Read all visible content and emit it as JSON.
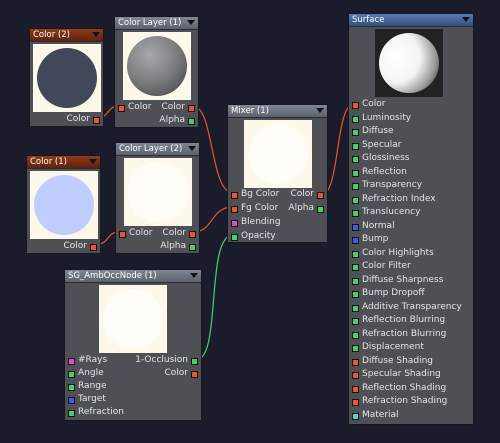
{
  "colors": {
    "background": "#1b1c2b",
    "wire_orange": "#f0532a",
    "wire_green": "#3fd36a",
    "port_orange": "#f0532a",
    "port_green": "#3fd36a",
    "port_blue": "#3f5ce8",
    "port_pink": "#e246d6",
    "swatch_color2": "#40485a",
    "swatch_color1": "#c0cdff"
  },
  "nodes": {
    "color2": {
      "title": "Color (2)",
      "out_color": "Color"
    },
    "color1": {
      "title": "Color (1)",
      "out_color": "Color"
    },
    "colorlayer1": {
      "title": "Color Layer (1)",
      "in_color": "Color",
      "out_color": "Color",
      "out_alpha": "Alpha"
    },
    "colorlayer2": {
      "title": "Color Layer (2)",
      "in_color": "Color",
      "out_color": "Color",
      "out_alpha": "Alpha"
    },
    "mixer": {
      "title": "Mixer (1)",
      "bg_color": "Bg Color",
      "fg_color": "Fg Color",
      "blending": "Blending",
      "opacity": "Opacity",
      "out_color": "Color",
      "out_alpha": "Alpha"
    },
    "ambocc": {
      "title": "SG_AmbOccNode (1)",
      "rays": "#Rays",
      "angle": "Angle",
      "range": "Range",
      "target": "Target",
      "refraction": "Refraction",
      "out_occlusion": "1-Occlusion",
      "out_color": "Color"
    },
    "surface": {
      "title": "Surface",
      "inputs": [
        {
          "label": "Color",
          "port": "orange"
        },
        {
          "label": "Luminosity",
          "port": "green"
        },
        {
          "label": "Diffuse",
          "port": "green"
        },
        {
          "label": "Specular",
          "port": "green"
        },
        {
          "label": "Glossiness",
          "port": "green"
        },
        {
          "label": "Reflection",
          "port": "green"
        },
        {
          "label": "Transparency",
          "port": "green"
        },
        {
          "label": "Refraction Index",
          "port": "green"
        },
        {
          "label": "Translucency",
          "port": "green"
        },
        {
          "label": "Normal",
          "port": "blue"
        },
        {
          "label": "Bump",
          "port": "blue"
        },
        {
          "label": "Color Highlights",
          "port": "green"
        },
        {
          "label": "Color Filter",
          "port": "green"
        },
        {
          "label": "Diffuse Sharpness",
          "port": "green"
        },
        {
          "label": "Bump Dropoff",
          "port": "green"
        },
        {
          "label": "Additive Transparency",
          "port": "green"
        },
        {
          "label": "Reflection Blurring",
          "port": "green"
        },
        {
          "label": "Refraction Blurring",
          "port": "green"
        },
        {
          "label": "Displacement",
          "port": "green"
        },
        {
          "label": "Diffuse Shading",
          "port": "orange"
        },
        {
          "label": "Specular Shading",
          "port": "orange"
        },
        {
          "label": "Reflection Shading",
          "port": "orange"
        },
        {
          "label": "Refraction Shading",
          "port": "orange"
        },
        {
          "label": "Material",
          "port": "cyan"
        }
      ]
    }
  }
}
